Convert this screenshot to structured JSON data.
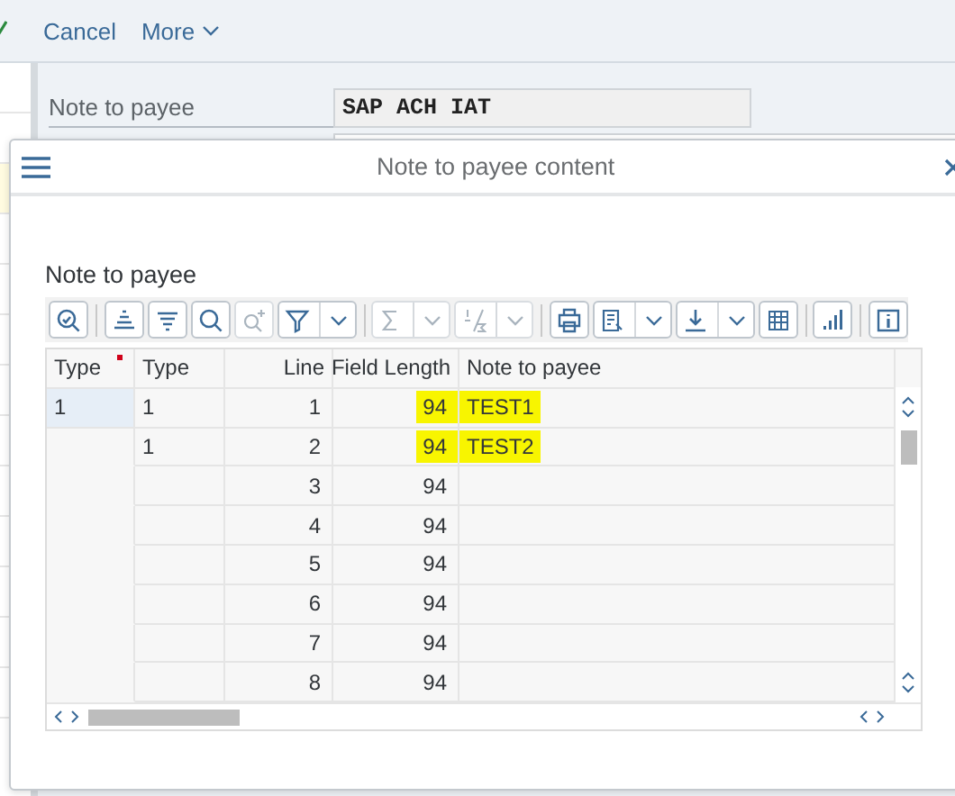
{
  "top_bar": {
    "actions": [
      {
        "label": "Cancel",
        "dropdown": false
      },
      {
        "label": "More",
        "dropdown": true
      }
    ]
  },
  "form": {
    "fields": [
      {
        "label": "Note to payee",
        "value": "SAP ACH IAT"
      }
    ]
  },
  "dialog": {
    "title": "Note to payee content",
    "section_title": "Note to payee",
    "toolbar": [
      [
        {
          "kind": "details",
          "dropdown": false,
          "disabled": false
        }
      ],
      [
        {
          "kind": "sort-ascending",
          "dropdown": false,
          "disabled": false
        },
        {
          "kind": "sort-descending",
          "dropdown": false,
          "disabled": false
        },
        {
          "kind": "find",
          "dropdown": false,
          "disabled": false
        },
        {
          "kind": "find-next",
          "dropdown": false,
          "disabled": true
        },
        {
          "kind": "filter",
          "dropdown": true,
          "disabled": false
        }
      ],
      [
        {
          "kind": "sum",
          "dropdown": true,
          "disabled": true
        },
        {
          "kind": "subtotal",
          "dropdown": true,
          "disabled": true
        }
      ],
      [
        {
          "kind": "print",
          "dropdown": false,
          "disabled": false
        },
        {
          "kind": "view",
          "dropdown": true,
          "disabled": false
        },
        {
          "kind": "export",
          "dropdown": true,
          "disabled": false
        },
        {
          "kind": "layout",
          "dropdown": false,
          "disabled": false
        }
      ],
      [
        {
          "kind": "chart",
          "dropdown": false,
          "disabled": false
        }
      ],
      [
        {
          "kind": "info",
          "dropdown": false,
          "disabled": false
        }
      ]
    ],
    "table": {
      "columns": [
        "Type",
        "Type",
        "Line",
        "Field Length",
        "Note to payee"
      ],
      "rows": [
        {
          "type": "1",
          "type_2": "1",
          "line": "1",
          "field_length": "94",
          "note": "TEST1",
          "highlighted": true
        },
        {
          "type_2": "1",
          "line": "2",
          "field_length": "94",
          "note": "TEST2",
          "highlighted": true
        },
        {
          "line": "3",
          "field_length": "94",
          "highlighted": false
        },
        {
          "line": "4",
          "field_length": "94",
          "highlighted": false
        },
        {
          "line": "5",
          "field_length": "94",
          "highlighted": false
        },
        {
          "line": "6",
          "field_length": "94",
          "highlighted": false
        },
        {
          "line": "7",
          "field_length": "94",
          "highlighted": false
        },
        {
          "line": "8",
          "field_length": "94",
          "highlighted": false
        }
      ]
    }
  }
}
